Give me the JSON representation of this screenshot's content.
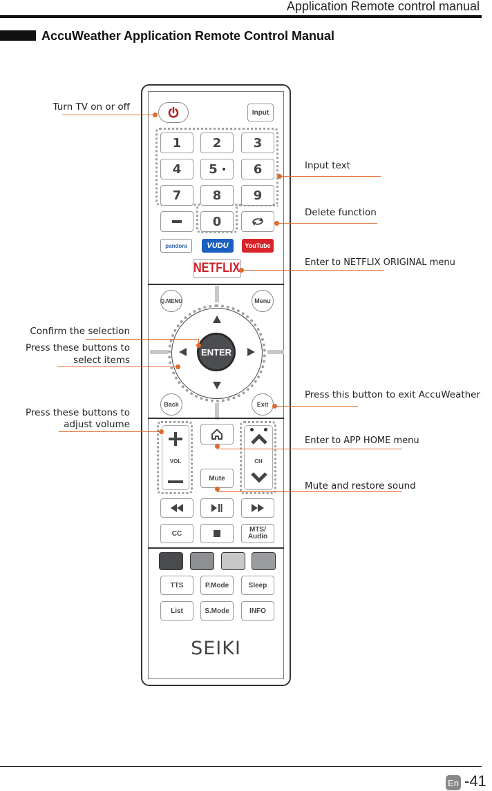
{
  "header": {
    "running_title": "Application Remote control manual",
    "section_title": "AccuWeather Application Remote Control Manual"
  },
  "annotations": {
    "power": "Turn TV on or off",
    "input_text": "Input text",
    "delete": "Delete function",
    "netflix": "Enter to NETFLIX ORIGINAL menu",
    "confirm": "Confirm the selection",
    "select_line1": "Press these buttons to",
    "select_line2": "select items",
    "exit": "Press this button to exit AccuWeather",
    "volume_line1": "Press these buttons to",
    "volume_line2": "adjust volume",
    "home": "Enter to APP HOME menu",
    "mute": "Mute and restore sound"
  },
  "remote": {
    "input": "Input",
    "digits": [
      "1",
      "2",
      "3",
      "4",
      "5",
      "6",
      "7",
      "8",
      "9"
    ],
    "zero": "0",
    "apps": {
      "pandora": "pandora",
      "vudu": "VUDU",
      "youtube": "YouTube",
      "netflix": "NETFLIX"
    },
    "qmenu": "Q.MENU",
    "menu": "Menu",
    "enter": "ENTER",
    "back": "Back",
    "exit": "Exit",
    "vol": "VOL",
    "ch": "CH",
    "mute": "Mute",
    "cc": "CC",
    "mts_line1": "MTS/",
    "mts_line2": "Audio",
    "tts": "TTS",
    "pmode": "P.Mode",
    "sleep": "Sleep",
    "list": "List",
    "smode": "S.Mode",
    "info": "INFO",
    "brand": "SEIKI",
    "color_keys": [
      "#4a4b4f",
      "#8e8f93",
      "#c8c8c8",
      "#9b9c9f"
    ]
  },
  "footer": {
    "lang": "En",
    "page": "-41"
  },
  "colors": {
    "accent": "#e06a2c"
  }
}
